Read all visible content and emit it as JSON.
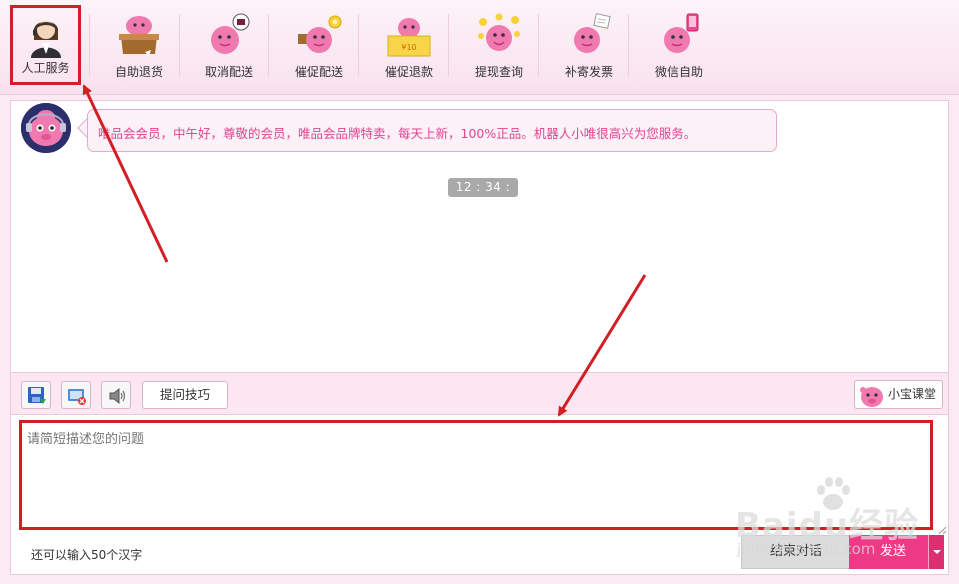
{
  "toolbar": {
    "items": [
      {
        "label": "人工服务",
        "icon": "customer-service-icon"
      },
      {
        "label": "自助退货",
        "icon": "return-goods-icon"
      },
      {
        "label": "取消配送",
        "icon": "cancel-delivery-icon"
      },
      {
        "label": "催促配送",
        "icon": "urge-delivery-icon"
      },
      {
        "label": "催促退款",
        "icon": "urge-refund-icon"
      },
      {
        "label": "提现查询",
        "icon": "withdraw-query-icon"
      },
      {
        "label": "补寄发票",
        "icon": "resend-invoice-icon"
      },
      {
        "label": "微信自助",
        "icon": "wechat-self-service-icon"
      }
    ],
    "refund_ticket_text": "¥10"
  },
  "chat": {
    "greeting": "唯品会会员，中午好，尊敬的会员，唯品会品牌特卖，每天上新，100%正品。机器人小唯很高兴为您服务。",
    "timestamp": "12 : 34 : 12"
  },
  "input_bar": {
    "tips_label": "提问技巧",
    "class_label": "小宝课堂"
  },
  "input": {
    "placeholder": "请简短描述您的问题",
    "counter": "还可以输入50个汉字",
    "end_label": "结束对话",
    "send_label": "发送"
  },
  "watermark": {
    "text": "Baidu经验",
    "sub": "jingyan.baidu.com"
  },
  "colors": {
    "brand_pink": "#ee3a86",
    "annotation_red": "#d21e25",
    "bubble_text": "#e0448f"
  }
}
